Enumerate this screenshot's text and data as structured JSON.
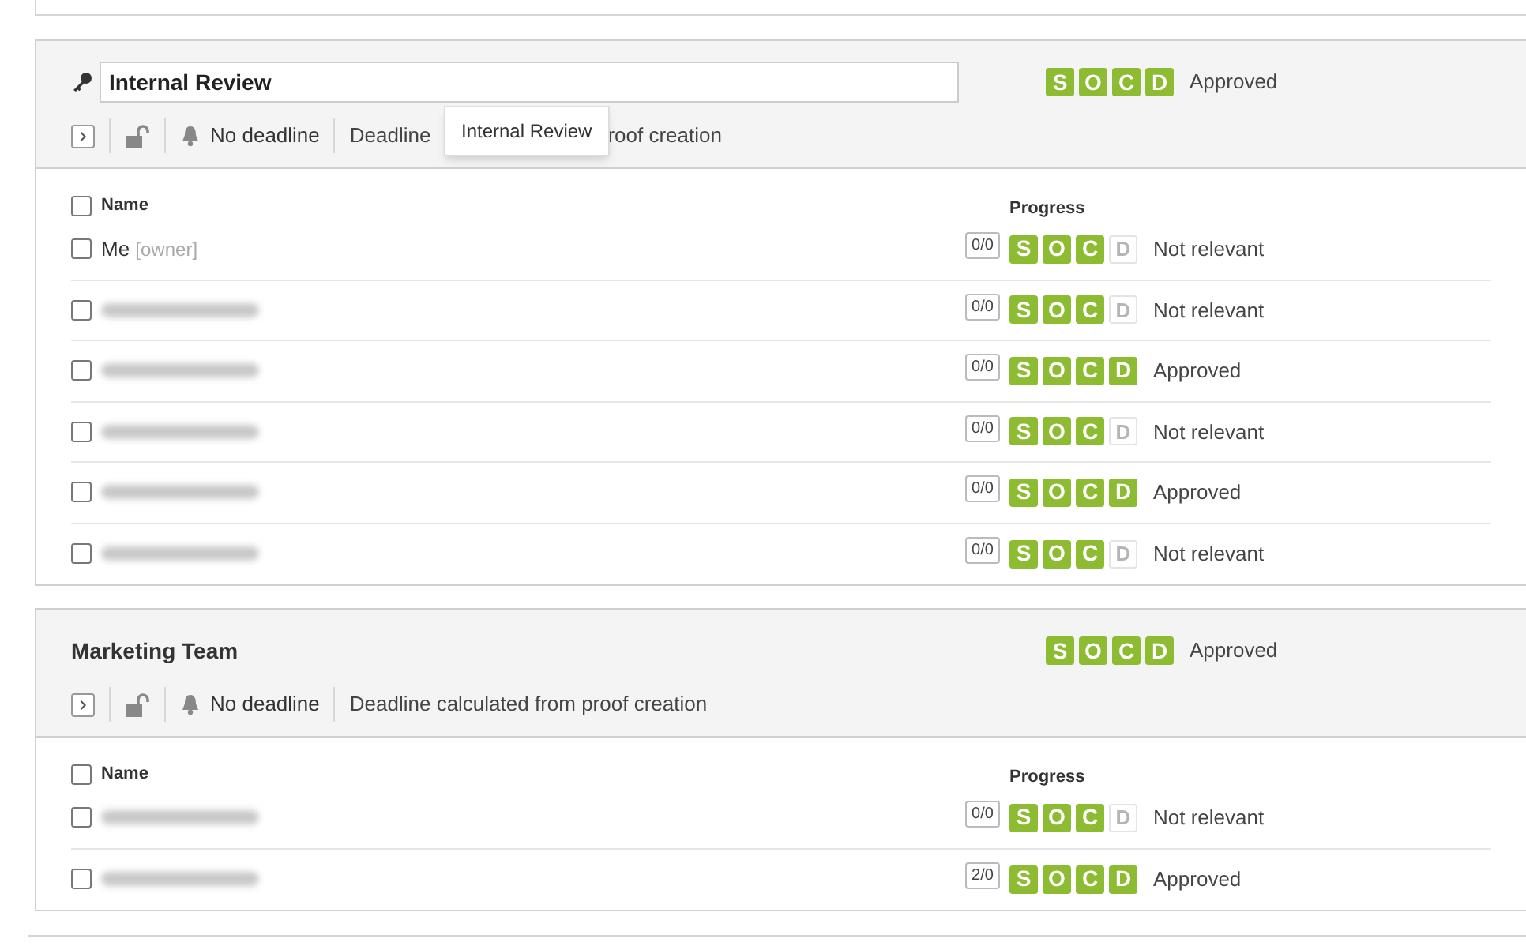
{
  "groups": [
    {
      "kind": "editable",
      "title": "Internal Review",
      "badges": [
        {
          "letter": "S",
          "on": true
        },
        {
          "letter": "O",
          "on": true
        },
        {
          "letter": "C",
          "on": true
        },
        {
          "letter": "D",
          "on": true
        }
      ],
      "status": "Approved",
      "deadline": "No deadline",
      "deadline_note": [
        "Deadline",
        "roof creation"
      ],
      "tooltip": "Internal Review",
      "columns": {
        "name": "Name",
        "progress": "Progress",
        "checked": false
      },
      "rows": [
        {
          "kind": "named",
          "checked": false,
          "name": "Me",
          "role": "[owner]",
          "comments": "0/0",
          "badges": [
            {
              "letter": "S",
              "on": true
            },
            {
              "letter": "O",
              "on": true
            },
            {
              "letter": "C",
              "on": true
            },
            {
              "letter": "D",
              "on": false
            }
          ],
          "status": "Not relevant"
        },
        {
          "kind": "redacted",
          "checked": false,
          "comments": "0/0",
          "badges": [
            {
              "letter": "S",
              "on": true
            },
            {
              "letter": "O",
              "on": true
            },
            {
              "letter": "C",
              "on": true
            },
            {
              "letter": "D",
              "on": false
            }
          ],
          "status": "Not relevant"
        },
        {
          "kind": "redacted",
          "checked": false,
          "comments": "0/0",
          "badges": [
            {
              "letter": "S",
              "on": true
            },
            {
              "letter": "O",
              "on": true
            },
            {
              "letter": "C",
              "on": true
            },
            {
              "letter": "D",
              "on": true
            }
          ],
          "status": "Approved"
        },
        {
          "kind": "redacted",
          "checked": false,
          "comments": "0/0",
          "badges": [
            {
              "letter": "S",
              "on": true
            },
            {
              "letter": "O",
              "on": true
            },
            {
              "letter": "C",
              "on": true
            },
            {
              "letter": "D",
              "on": false
            }
          ],
          "status": "Not relevant"
        },
        {
          "kind": "redacted",
          "checked": false,
          "comments": "0/0",
          "badges": [
            {
              "letter": "S",
              "on": true
            },
            {
              "letter": "O",
              "on": true
            },
            {
              "letter": "C",
              "on": true
            },
            {
              "letter": "D",
              "on": true
            }
          ],
          "status": "Approved"
        },
        {
          "kind": "redacted",
          "checked": false,
          "comments": "0/0",
          "badges": [
            {
              "letter": "S",
              "on": true
            },
            {
              "letter": "O",
              "on": true
            },
            {
              "letter": "C",
              "on": true
            },
            {
              "letter": "D",
              "on": false
            }
          ],
          "status": "Not relevant"
        }
      ]
    },
    {
      "kind": "plain",
      "title": "Marketing Team",
      "badges": [
        {
          "letter": "S",
          "on": true
        },
        {
          "letter": "O",
          "on": true
        },
        {
          "letter": "C",
          "on": true
        },
        {
          "letter": "D",
          "on": true
        }
      ],
      "status": "Approved",
      "deadline": "No deadline",
      "deadline_note": [
        "Deadline calculated from proof creation"
      ],
      "columns": {
        "name": "Name",
        "progress": "Progress",
        "checked": false
      },
      "rows": [
        {
          "kind": "redacted",
          "checked": false,
          "comments": "0/0",
          "badges": [
            {
              "letter": "S",
              "on": true
            },
            {
              "letter": "O",
              "on": true
            },
            {
              "letter": "C",
              "on": true
            },
            {
              "letter": "D",
              "on": false
            }
          ],
          "status": "Not relevant"
        },
        {
          "kind": "redacted",
          "checked": false,
          "comments": "2/0",
          "badges": [
            {
              "letter": "S",
              "on": true
            },
            {
              "letter": "O",
              "on": true
            },
            {
              "letter": "C",
              "on": true
            },
            {
              "letter": "D",
              "on": true
            }
          ],
          "status": "Approved"
        }
      ]
    }
  ]
}
